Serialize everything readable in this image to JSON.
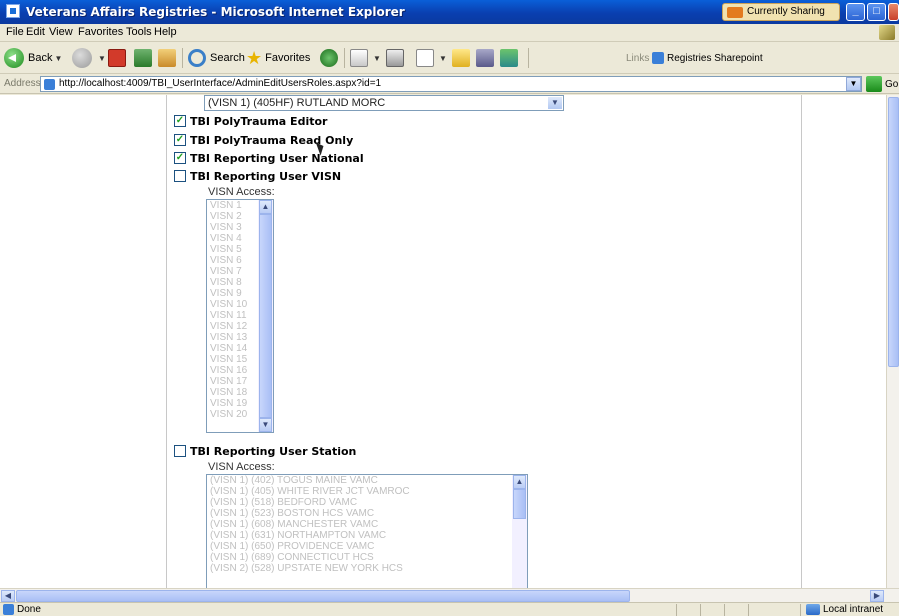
{
  "window": {
    "title": "Veterans Affairs Registries - Microsoft Internet Explorer",
    "sharing_label": "Currently Sharing"
  },
  "menu": {
    "items": [
      "File",
      "Edit",
      "View",
      "Favorites",
      "Tools",
      "Help"
    ]
  },
  "toolbar": {
    "back_label": "Back",
    "search_label": "Search",
    "favorites_label": "Favorites",
    "links_label": "Links",
    "sharepoint_label": "Registries Sharepoint"
  },
  "address": {
    "label": "Address",
    "url": "http://localhost:4009/TBI_UserInterface/AdminEditUsersRoles.aspx?id=1",
    "go_label": "Go"
  },
  "content": {
    "station_selected": "(VISN 1) (405HF) RUTLAND MORC",
    "roles": [
      {
        "label": "TBI PolyTrauma Editor",
        "checked": true
      },
      {
        "label": "TBI PolyTrauma Read Only",
        "checked": true
      },
      {
        "label": "TBI Reporting User National",
        "checked": true
      },
      {
        "label": "TBI Reporting User VISN",
        "checked": false
      },
      {
        "label": "TBI Reporting User Station",
        "checked": false
      }
    ],
    "visn_access_label": "VISN Access:",
    "visn_options": [
      "VISN 1",
      "VISN 2",
      "VISN 3",
      "VISN 4",
      "VISN 5",
      "VISN 6",
      "VISN 7",
      "VISN 8",
      "VISN 9",
      "VISN 10",
      "VISN 11",
      "VISN 12",
      "VISN 13",
      "VISN 14",
      "VISN 15",
      "VISN 16",
      "VISN 17",
      "VISN 18",
      "VISN 19",
      "VISN 20"
    ],
    "station_options": [
      "(VISN 1) (402) TOGUS MAINE VAMC",
      "(VISN 1) (405) WHITE RIVER JCT VAMROC",
      "(VISN 1) (518) BEDFORD VAMC",
      "(VISN 1) (523) BOSTON HCS VAMC",
      "(VISN 1) (608) MANCHESTER VAMC",
      "(VISN 1) (631) NORTHAMPTON VAMC",
      "(VISN 1) (650) PROVIDENCE VAMC",
      "(VISN 1) (689) CONNECTICUT HCS",
      "(VISN 2) (528) UPSTATE NEW YORK HCS"
    ]
  },
  "status": {
    "text": "Done",
    "zone": "Local intranet"
  }
}
